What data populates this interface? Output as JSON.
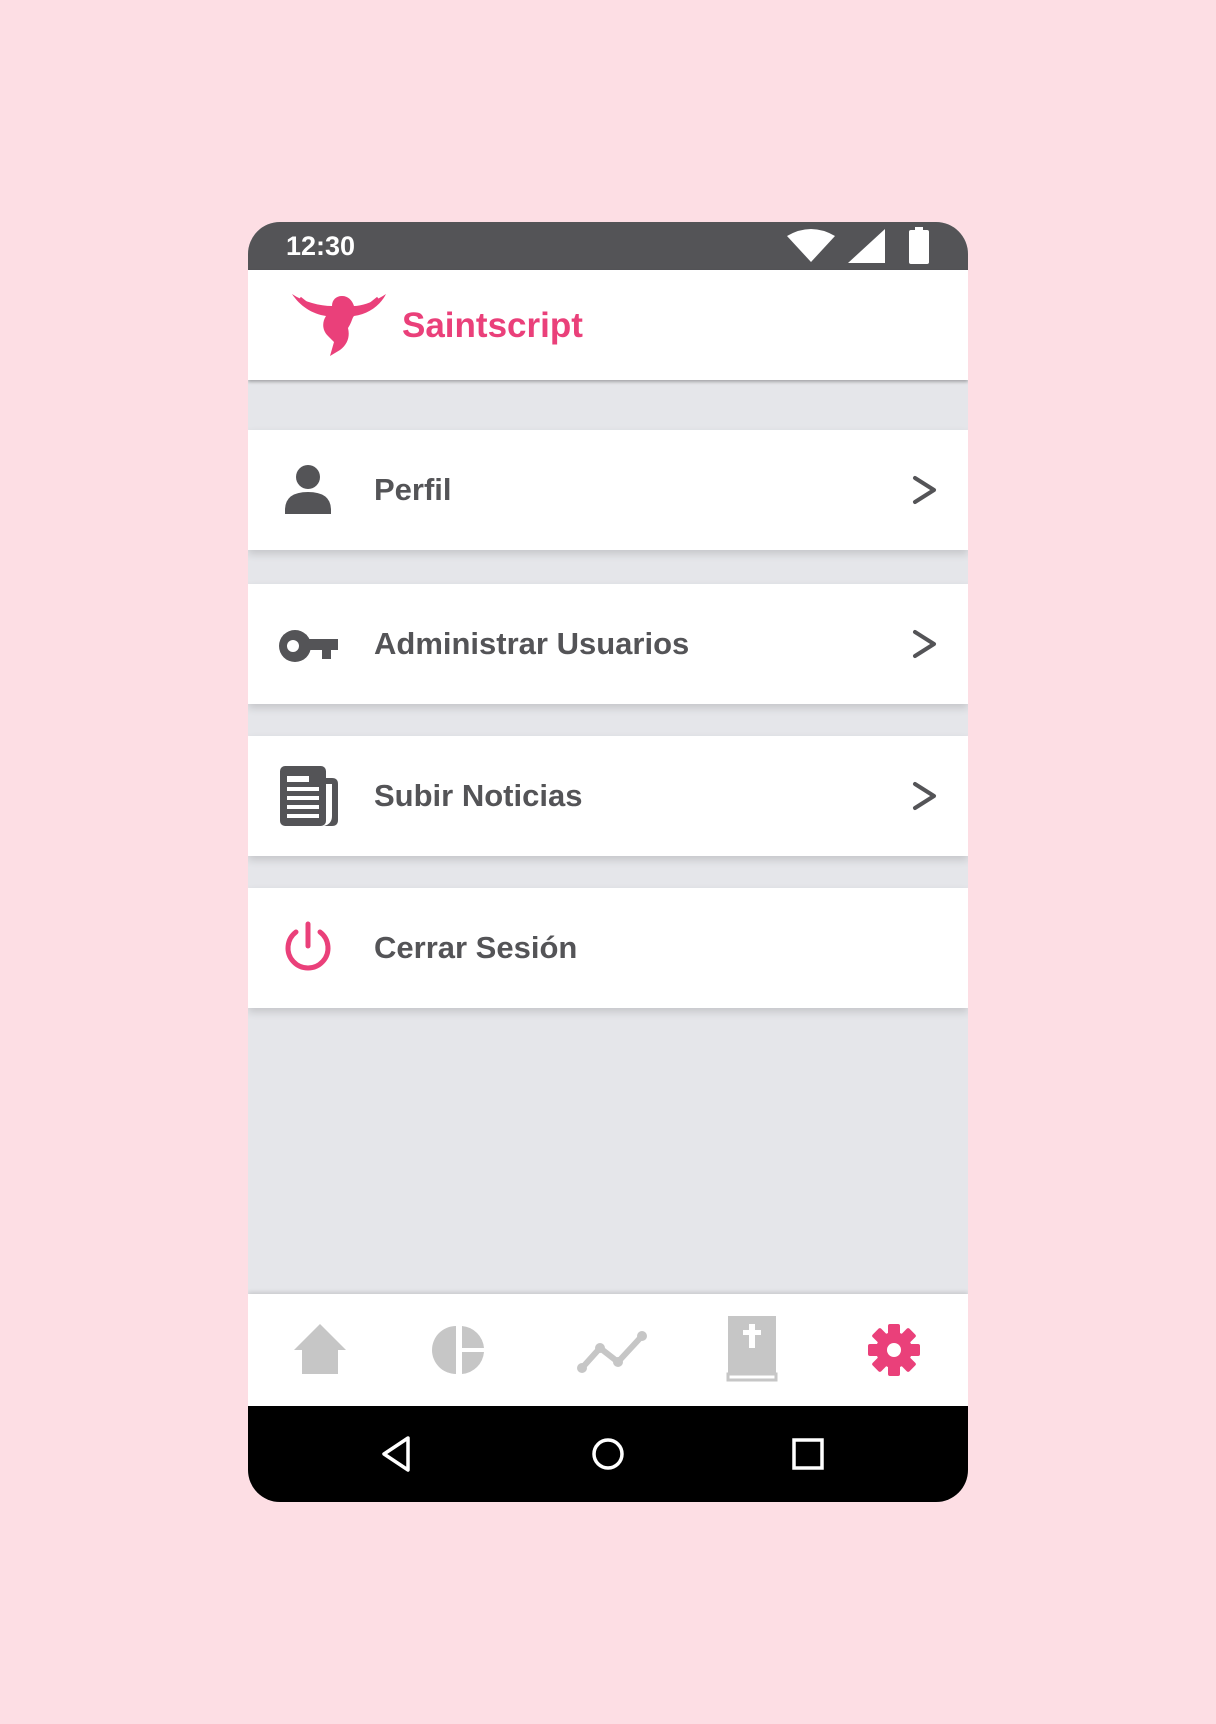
{
  "status_bar": {
    "time": "12:30",
    "icons": [
      "wifi-icon",
      "signal-icon",
      "battery-icon"
    ]
  },
  "app_bar": {
    "title": "Saintscript",
    "logo": "dove-logo"
  },
  "menu": {
    "items": [
      {
        "label": "Perfil",
        "icon": "person-icon",
        "chevron": ">"
      },
      {
        "label": "Administrar Usuarios",
        "icon": "key-icon",
        "chevron": ">"
      },
      {
        "label": "Subir Noticias",
        "icon": "newspaper-icon",
        "chevron": ">"
      },
      {
        "label": "Cerrar Sesión",
        "icon": "power-icon"
      }
    ]
  },
  "bottom_nav": {
    "items": [
      "home-icon",
      "pie-chart-icon",
      "trend-line-icon",
      "bible-icon",
      "settings-icon"
    ],
    "active": "settings-icon"
  },
  "system_nav": {
    "items": [
      "back-icon",
      "home-circle-icon",
      "recents-icon"
    ]
  },
  "colors": {
    "background": "#fddee4",
    "accent": "#ea407a",
    "status_bar": "#545457",
    "text": "#545457",
    "content_bg": "#e5e6ea",
    "inactive_icon": "#c6c6c6"
  }
}
